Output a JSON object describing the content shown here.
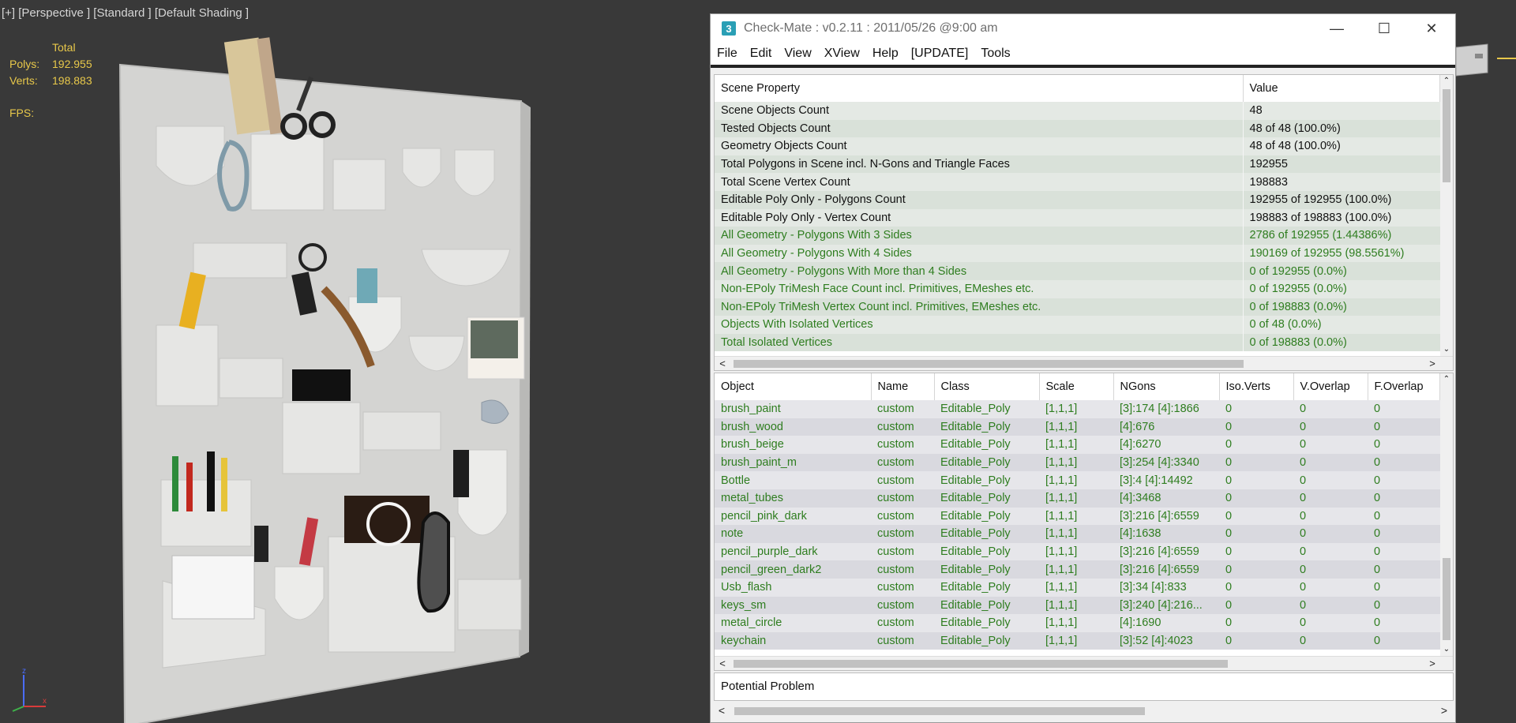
{
  "viewport": {
    "label": "[+] [Perspective ] [Standard ] [Default Shading ]",
    "stats": {
      "header": "Total",
      "polys_label": "Polys:",
      "polys_value": "192.955",
      "verts_label": "Verts:",
      "verts_value": "198.883",
      "fps_label": "FPS:"
    },
    "axis": {
      "z": "z",
      "x": "x"
    }
  },
  "window": {
    "icon": "3",
    "title": "Check-Mate : v0.2.11 : 2011/05/26 @9:00 am",
    "controls": {
      "minimize": "—",
      "maximize": "☐",
      "close": "✕"
    },
    "menu": [
      "File",
      "Edit",
      "View",
      "XView",
      "Help",
      "[UPDATE]",
      "Tools"
    ]
  },
  "properties": {
    "headers": [
      "Scene Property",
      "Value"
    ],
    "rows": [
      {
        "name": "Scene Objects Count",
        "value": "48",
        "green": false
      },
      {
        "name": "Tested Objects Count",
        "value": "48 of 48 (100.0%)",
        "green": false
      },
      {
        "name": "Geometry Objects Count",
        "value": "48 of 48 (100.0%)",
        "green": false
      },
      {
        "name": "Total Polygons in Scene incl. N-Gons and Triangle Faces",
        "value": "192955",
        "green": false
      },
      {
        "name": "Total Scene Vertex Count",
        "value": "198883",
        "green": false
      },
      {
        "name": "Editable Poly Only - Polygons Count",
        "value": "192955 of 192955 (100.0%)",
        "green": false
      },
      {
        "name": "Editable Poly Only - Vertex Count",
        "value": "198883 of 198883 (100.0%)",
        "green": false
      },
      {
        "name": "All Geometry - Polygons With 3 Sides",
        "value": "2786 of 192955 (1.44386%)",
        "green": true
      },
      {
        "name": "All Geometry - Polygons With 4 Sides",
        "value": "190169 of 192955 (98.5561%)",
        "green": true
      },
      {
        "name": "All Geometry - Polygons With More than 4 Sides",
        "value": "0 of 192955 (0.0%)",
        "green": true
      },
      {
        "name": "Non-EPoly TriMesh Face Count incl. Primitives, EMeshes etc.",
        "value": "0 of 192955 (0.0%)",
        "green": true
      },
      {
        "name": "Non-EPoly TriMesh Vertex Count incl. Primitives, EMeshes etc.",
        "value": "0 of 198883 (0.0%)",
        "green": true
      },
      {
        "name": "Objects With Isolated Vertices",
        "value": "0 of 48 (0.0%)",
        "green": true
      },
      {
        "name": "Total Isolated Vertices",
        "value": "0 of 198883 (0.0%)",
        "green": true
      }
    ]
  },
  "objects": {
    "headers": [
      "Object",
      "Name",
      "Class",
      "Scale",
      "NGons",
      "Iso.Verts",
      "V.Overlap",
      "F.Overlap"
    ],
    "rows": [
      [
        "brush_paint",
        "custom",
        "Editable_Poly",
        "[1,1,1]",
        "[3]:174 [4]:1866",
        "0",
        "0",
        "0"
      ],
      [
        "brush_wood",
        "custom",
        "Editable_Poly",
        "[1,1,1]",
        "[4]:676",
        "0",
        "0",
        "0"
      ],
      [
        "brush_beige",
        "custom",
        "Editable_Poly",
        "[1,1,1]",
        "[4]:6270",
        "0",
        "0",
        "0"
      ],
      [
        "brush_paint_m",
        "custom",
        "Editable_Poly",
        "[1,1,1]",
        "[3]:254 [4]:3340",
        "0",
        "0",
        "0"
      ],
      [
        "Bottle",
        "custom",
        "Editable_Poly",
        "[1,1,1]",
        "[3]:4 [4]:14492",
        "0",
        "0",
        "0"
      ],
      [
        "metal_tubes",
        "custom",
        "Editable_Poly",
        "[1,1,1]",
        "[4]:3468",
        "0",
        "0",
        "0"
      ],
      [
        "pencil_pink_dark",
        "custom",
        "Editable_Poly",
        "[1,1,1]",
        "[3]:216 [4]:6559",
        "0",
        "0",
        "0"
      ],
      [
        "note",
        "custom",
        "Editable_Poly",
        "[1,1,1]",
        "[4]:1638",
        "0",
        "0",
        "0"
      ],
      [
        "pencil_purple_dark",
        "custom",
        "Editable_Poly",
        "[1,1,1]",
        "[3]:216 [4]:6559",
        "0",
        "0",
        "0"
      ],
      [
        "pencil_green_dark2",
        "custom",
        "Editable_Poly",
        "[1,1,1]",
        "[3]:216 [4]:6559",
        "0",
        "0",
        "0"
      ],
      [
        "Usb_flash",
        "custom",
        "Editable_Poly",
        "[1,1,1]",
        "[3]:34 [4]:833",
        "0",
        "0",
        "0"
      ],
      [
        "keys_sm",
        "custom",
        "Editable_Poly",
        "[1,1,1]",
        "[3]:240 [4]:216...",
        "0",
        "0",
        "0"
      ],
      [
        "metal_circle",
        "custom",
        "Editable_Poly",
        "[1,1,1]",
        "[4]:1690",
        "0",
        "0",
        "0"
      ],
      [
        "keychain",
        "custom",
        "Editable_Poly",
        "[1,1,1]",
        "[3]:52 [4]:4023",
        "0",
        "0",
        "0"
      ]
    ]
  },
  "problem": {
    "label": "Potential Problem"
  },
  "scroll_arrows": {
    "up": "⌃",
    "down": "⌄",
    "left": "<",
    "right": ">"
  }
}
